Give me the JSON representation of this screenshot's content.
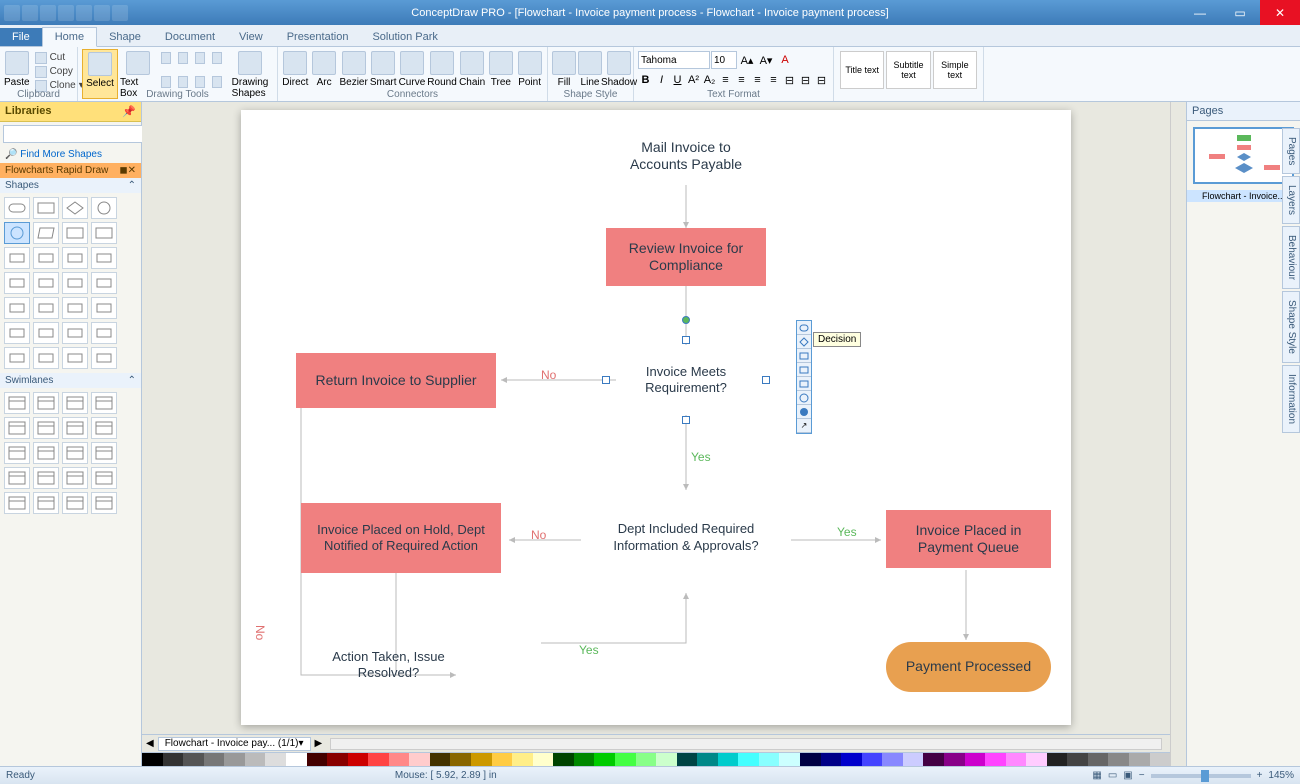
{
  "window": {
    "title": "ConceptDraw PRO - [Flowchart - Invoice payment process - Flowchart - Invoice payment process]"
  },
  "menu": {
    "file": "File",
    "tabs": [
      "Home",
      "Shape",
      "Document",
      "View",
      "Presentation",
      "Solution Park"
    ],
    "active": "Home"
  },
  "ribbon": {
    "clipboard": {
      "label": "Clipboard",
      "paste": "Paste",
      "cut": "Cut",
      "copy": "Copy",
      "clone": "Clone"
    },
    "drawing": {
      "label": "Drawing Tools",
      "select": "Select",
      "textbox": "Text Box",
      "shapes": "Drawing Shapes"
    },
    "connectors": {
      "label": "Connectors",
      "items": [
        "Direct",
        "Arc",
        "Bezier",
        "Smart",
        "Curve",
        "Round",
        "Chain",
        "Tree",
        "Point"
      ]
    },
    "shapestyle": {
      "label": "Shape Style",
      "fill": "Fill",
      "line": "Line",
      "shadow": "Shadow"
    },
    "textformat": {
      "label": "Text Format",
      "font": "Tahoma",
      "size": "10"
    },
    "styles": {
      "title": "Title text",
      "subtitle": "Subtitle text",
      "simple": "Simple text"
    }
  },
  "left": {
    "libraries": "Libraries",
    "findmore": "Find More Shapes",
    "section": "Flowcharts Rapid Draw",
    "shapes": "Shapes",
    "swimlanes": "Swimlanes"
  },
  "right": {
    "pages": "Pages",
    "thumb": "Flowchart - Invoice...",
    "sidetabs": [
      "Pages",
      "Layers",
      "Behaviour",
      "Shape Style",
      "Information"
    ]
  },
  "flowchart": {
    "n1": "Mail Invoice to Accounts Payable",
    "n2": "Review Invoice for Compliance",
    "n3": "Invoice Meets Requirement?",
    "n4": "Return Invoice to Supplier",
    "n5": "Dept Included Required Information & Approvals?",
    "n6": "Invoice Placed on Hold, Dept Notified of Required Action",
    "n7": "Invoice Placed in Payment Queue",
    "n8": "Action Taken, Issue Resolved?",
    "n9": "Payment Processed",
    "yes": "Yes",
    "no": "No"
  },
  "popup": {
    "tooltip": "Decision"
  },
  "pagetab": {
    "label": "Flowchart - Invoice pay...",
    "pages": "1/1"
  },
  "status": {
    "ready": "Ready",
    "mouse": "Mouse: [ 5.92, 2.89 ] in",
    "zoom": "145%"
  }
}
